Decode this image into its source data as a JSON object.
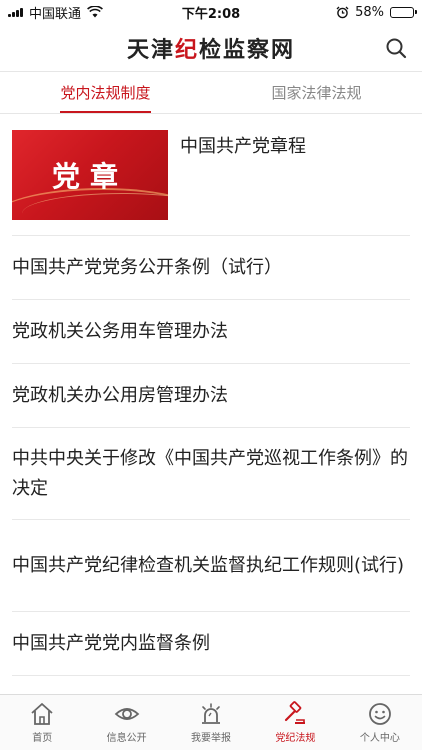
{
  "status": {
    "carrier": "中国联通",
    "time": "下午2:08",
    "battery": "58%",
    "battery_level": 0.58
  },
  "header": {
    "brand_part1": "天津",
    "brand_accent": "纪",
    "brand_part2": "检监察网",
    "search_icon": "search-icon"
  },
  "tabs": [
    {
      "label": "党内法规制度",
      "active": true
    },
    {
      "label": "国家法律法规",
      "active": false
    }
  ],
  "featured": {
    "thumb_text": "党章",
    "title": "中国共产党章程"
  },
  "items": [
    {
      "title": "中国共产党党务公开条例（试行）"
    },
    {
      "title": "党政机关公务用车管理办法"
    },
    {
      "title": "党政机关办公用房管理办法"
    },
    {
      "title": "中共中央关于修改《中国共产党巡视工作条例》的决定"
    },
    {
      "title": "中国共产党纪律检查机关监督执纪工作规则(试行)"
    },
    {
      "title": "中国共产党党内监督条例"
    }
  ],
  "nav": [
    {
      "label": "首页",
      "icon": "home-icon",
      "active": false
    },
    {
      "label": "信息公开",
      "icon": "eye-icon",
      "active": false
    },
    {
      "label": "我要举报",
      "icon": "alarm-icon",
      "active": false
    },
    {
      "label": "党纪法规",
      "icon": "gavel-icon",
      "active": true
    },
    {
      "label": "个人中心",
      "icon": "smile-face-icon",
      "active": false
    }
  ],
  "colors": {
    "accent": "#c8161d",
    "inactive": "#888888"
  }
}
